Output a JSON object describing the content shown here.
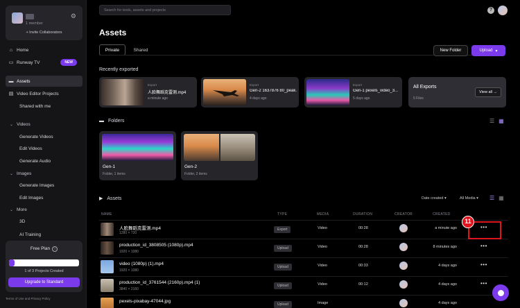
{
  "workspace": {
    "member_text": "1 member",
    "invite_label": "+ Invite Collaborators"
  },
  "nav": {
    "home": "Home",
    "runway_tv": "Runway TV",
    "new_badge": "NEW",
    "assets": "Assets",
    "video_editor": "Video Editor Projects",
    "shared": "Shared with me",
    "videos_section": "Videos",
    "generate_videos": "Generate Videos",
    "edit_videos": "Edit Videos",
    "generate_audio": "Generate Audio",
    "images_section": "Images",
    "generate_images": "Generate Images",
    "edit_images": "Edit Images",
    "more_section": "More",
    "three_d": "3D",
    "ai_training": "AI Training"
  },
  "plan": {
    "title": "Free Plan",
    "count_text": "1 of 3 Projects Created",
    "projects_used": 1,
    "projects_total": 3,
    "upgrade_label": "Upgrade to Standard",
    "terms_text": "Terms of Use and Privacy Policy"
  },
  "topbar": {
    "search_placeholder": "Search for tools, assets and projects"
  },
  "header": {
    "title": "Assets",
    "tab_private": "Private",
    "tab_shared": "Shared",
    "new_folder": "New Folder",
    "upload": "Upload"
  },
  "recent": {
    "label": "Recently exported",
    "items": [
      {
        "kicker": "Export",
        "name": "人脸舞蹈克雷测.mp4",
        "time": "a minute ago"
      },
      {
        "kicker": "Export",
        "name": "Gen-2 1637876 80_peak...",
        "time": "4 days ago"
      },
      {
        "kicker": "Export",
        "name": "Gen-1 pexels_video_3...",
        "time": "5 days ago"
      }
    ],
    "all_exports_title": "All Exports",
    "all_exports_count": "5 Files",
    "view_all": "View all →"
  },
  "folders": {
    "label": "Folders",
    "items": [
      {
        "name": "Gen-1",
        "meta": "Folder, 1 items"
      },
      {
        "name": "Gen-2",
        "meta": "Folder, 2 items"
      }
    ]
  },
  "assets": {
    "label": "Assets",
    "sort_label": "Date created",
    "filter_label": "All Media",
    "columns": {
      "name": "NAME",
      "type": "TYPE",
      "media": "MEDIA",
      "duration": "DURATION",
      "creator": "CREATOR",
      "created": "CREATED"
    },
    "rows": [
      {
        "name": "人脸舞蹈克雷测.mp4",
        "dims": "1280 × 720",
        "type": "Export",
        "media": "Video",
        "duration": "00:28",
        "created": "a minute ago"
      },
      {
        "name": "production_id_3808505 (1080p).mp4",
        "dims": "1920 × 1080",
        "type": "Upload",
        "media": "Video",
        "duration": "00:28",
        "created": "8 minutes ago"
      },
      {
        "name": "video (1080p) (1).mp4",
        "dims": "1920 × 1080",
        "type": "Upload",
        "media": "Video",
        "duration": "00:33",
        "created": "4 days ago"
      },
      {
        "name": "production_id_3761544 (2160p).mp4 (1)",
        "dims": "3840 × 2160",
        "type": "Upload",
        "media": "Video",
        "duration": "00:12",
        "created": "4 days ago"
      },
      {
        "name": "pexels-pixabay-47044.jpg",
        "dims": "",
        "type": "Upload",
        "media": "Image",
        "duration": "",
        "created": "4 days ago"
      }
    ]
  },
  "annotation": {
    "step_number": "11"
  },
  "colors": {
    "accent": "#7c3aed",
    "highlight": "#e0141e",
    "background": "#000000",
    "panel": "#151517"
  }
}
